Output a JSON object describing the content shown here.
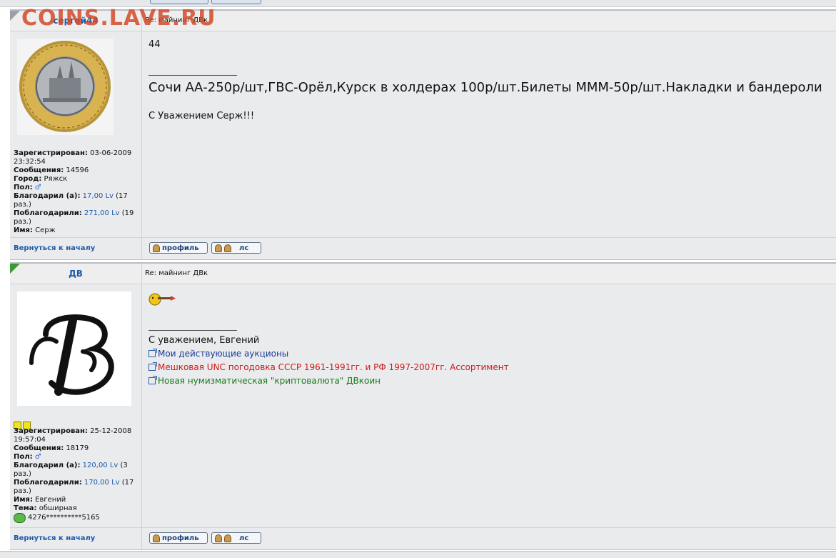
{
  "watermark": "COINS.LAVE.RU",
  "posts": [
    {
      "author": "сергей44",
      "subject": "Re: майнинг ДВк",
      "avatar": "coin-avatar",
      "profile": {
        "registered_label": "Зарегистрирован:",
        "registered_date": "03-06-2009",
        "registered_time": "23:32:54",
        "messages_label": "Сообщения:",
        "messages_value": "14596",
        "city_label": "Город:",
        "city_value": "Ряжск",
        "gender_label": "Пол:",
        "gender_icon": "♂",
        "thanked_label": "Благодарил (а):",
        "thanked_value": "17,00 Lv",
        "thanked_count_a": "(17",
        "thanked_count_b": "раз.)",
        "received_label": "Поблагодарили:",
        "received_value": "271,00 Lv",
        "received_count_a": "(19",
        "received_count_b": "раз.)",
        "name_label": "Имя:",
        "name_value": "Серж"
      },
      "body": {
        "first_line": "44",
        "ad_text": "Сочи АА-250р/шт,ГВС-Орёл,Курск в холдерах 100р/шт.Билеты МММ-50р/шт.Накладки и бандероли",
        "closing": "С Уважением Серж!!!"
      },
      "back_to_top": "Вернуться к началу",
      "buttons": {
        "profile": "профиль",
        "pm": "лс"
      }
    },
    {
      "author": "ДВ",
      "subject": "Re: майнинг ДВк",
      "avatar": "letter-b-avatar",
      "profile": {
        "registered_label": "Зарегистрирован:",
        "registered_date": "25-12-2008",
        "registered_time": "19:57:04",
        "messages_label": "Сообщения:",
        "messages_value": "18179",
        "gender_label": "Пол:",
        "gender_icon": "♂",
        "thanked_label": "Благодарил (а):",
        "thanked_value": "120,00 Lv",
        "thanked_count_a": "(3",
        "thanked_count_b": "раз.)",
        "received_label": "Поблагодарили:",
        "received_value": "170,00 Lv",
        "received_count_a": "(17",
        "received_count_b": "раз.)",
        "name_label": "Имя:",
        "name_value": "Евгений",
        "topic_label": "Тема:",
        "topic_value": "обширная",
        "wallet": "4276**********5165"
      },
      "body": {
        "greeting": "С уважением, Евгений",
        "links": [
          {
            "text": "Мои действующие аукционы",
            "color": "#1a3a9a"
          },
          {
            "text": "Мешковая UNC погодовка СССР 1961-1991гг. и РФ 1997-2007гг. Ассортимент",
            "color": "#d01818"
          },
          {
            "text": "Новая нумизматическая \"криптовалюта\" ДВкоин",
            "color": "#1a7a1a"
          }
        ]
      },
      "back_to_top": "Вернуться к началу",
      "buttons": {
        "profile": "профиль",
        "pm": "лс"
      }
    }
  ]
}
